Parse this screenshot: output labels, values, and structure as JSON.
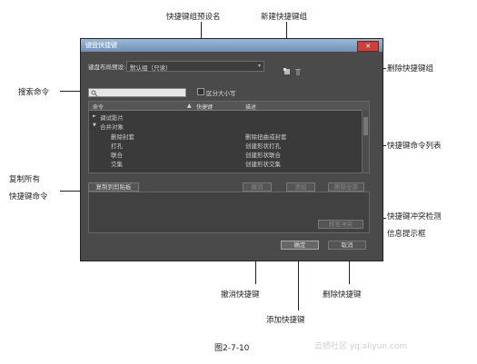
{
  "dialog": {
    "title": "键盘快捷键",
    "set_label": "键盘布局预设:",
    "set_value": "默认组（只读）",
    "search_placeholder": "",
    "case_label": "区分大小写",
    "columns": [
      "命令",
      "快捷键",
      "描述"
    ],
    "rows": [
      {
        "cmd": "调试影片",
        "shortcut": "",
        "desc": "",
        "expander": "►"
      },
      {
        "cmd": "合并对象",
        "shortcut": "",
        "desc": "",
        "expander": "▼"
      },
      {
        "cmd": "删除封套",
        "shortcut": "",
        "desc": "删除扭曲或封套",
        "expander": ""
      },
      {
        "cmd": "打孔",
        "shortcut": "",
        "desc": "创建形状打孔",
        "expander": ""
      },
      {
        "cmd": "联合",
        "shortcut": "",
        "desc": "创建形状联合",
        "expander": ""
      },
      {
        "cmd": "交集",
        "shortcut": "",
        "desc": "创建形状交集",
        "expander": ""
      }
    ],
    "copy_button": "复制到剪贴板",
    "undo_button": "撤消",
    "add_button": "添加",
    "remove_button": "删除全部",
    "go_conflict_button": "转至冲突",
    "ok_button": "确定",
    "cancel_button": "取消"
  },
  "annotations": {
    "preset_name": "快捷键组预设名",
    "new_set": "新建快捷键组",
    "delete_set": "删除快捷键组",
    "search_cmd": "搜索命令",
    "cmd_list": "快捷键命令列表",
    "copy_all_1": "复制所有",
    "copy_all_2": "快捷键命令",
    "conflict_1": "快捷键冲突检测",
    "conflict_2": "信息提示框",
    "undo": "撤消快捷键",
    "delete": "删除快捷键",
    "add": "添加快捷键"
  },
  "caption": "图2-7-10",
  "watermark": "云栖社区 yq.aliyun.com"
}
